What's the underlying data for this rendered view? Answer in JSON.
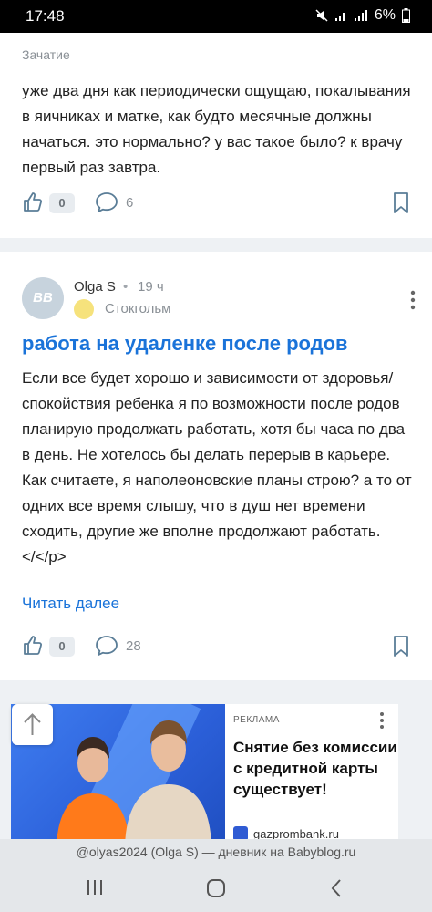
{
  "status_bar": {
    "time": "17:48",
    "battery_percent": "6%"
  },
  "post1": {
    "category": "Зачатие",
    "text": "уже два дня как периодически ощущаю, покалывания в яичниках и матке, как будто месячные должны начаться. это нормально? у вас такое было? к врачу первый раз завтра.",
    "likes": "0",
    "comments": "6"
  },
  "post2": {
    "avatar_text": "BB",
    "author": "Olga S",
    "separator": "•",
    "time_ago": "19 ч",
    "city": "Стокгольм",
    "title": "работа на удаленке после родов",
    "text": "Если все будет хорошо и зависимости от здоровья/спокойствия ребенка я по возможности после родов планирую продолжать работать, хотя бы часа по два в день. Не хотелось бы делать перерыв в карьере. Как считаете, я наполеоновские планы строю? а то от одних все время слышу, что в душ нет времени сходить, другие же вполне продолжают работать. </</p>",
    "read_more": "Читать далее",
    "likes": "0",
    "comments": "28"
  },
  "ad": {
    "label": "РЕКЛАМА",
    "headline": "Снятие без комиссии с кредитной карты существует!",
    "source": "gazprombank.ru"
  },
  "footer": {
    "text": "@olyas2024 (Olga S) — дневник на Babyblog.ru"
  },
  "colors": {
    "accent": "#1a73d9",
    "background": "#eef1f4"
  }
}
